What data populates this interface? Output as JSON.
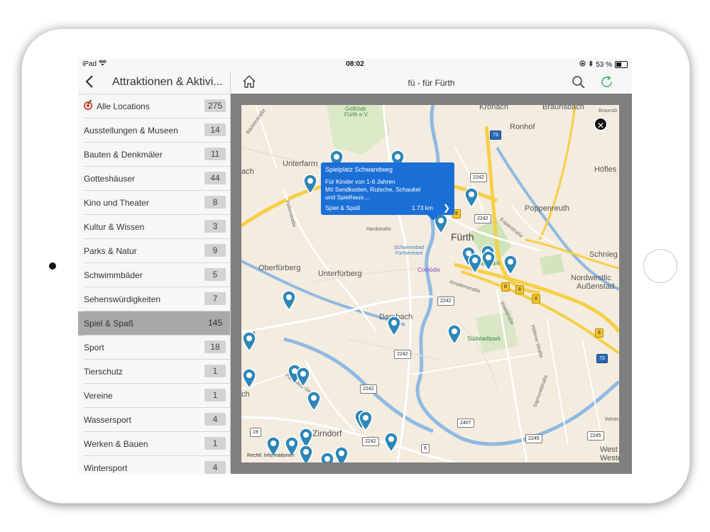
{
  "status_bar": {
    "device": "iPad",
    "time": "08:02",
    "battery": "53 %"
  },
  "sidebar": {
    "title": "Attraktionen & Aktivi...",
    "items": [
      {
        "label": "Alle Locations",
        "count": "275"
      },
      {
        "label": "Ausstellungen & Museen",
        "count": "14"
      },
      {
        "label": "Bauten & Denkmäler",
        "count": "11"
      },
      {
        "label": "Gotteshäuser",
        "count": "44"
      },
      {
        "label": "Kino und Theater",
        "count": "8"
      },
      {
        "label": "Kultur & Wissen",
        "count": "3"
      },
      {
        "label": "Parks & Natur",
        "count": "9"
      },
      {
        "label": "Schwimmbäder",
        "count": "5"
      },
      {
        "label": "Sehenswürdigkeiten",
        "count": "7"
      },
      {
        "label": "Spiel & Spaß",
        "count": "145"
      },
      {
        "label": "Sport",
        "count": "18"
      },
      {
        "label": "Tierschutz",
        "count": "1"
      },
      {
        "label": "Vereine",
        "count": "1"
      },
      {
        "label": "Wassersport",
        "count": "4"
      },
      {
        "label": "Werken & Bauen",
        "count": "1"
      },
      {
        "label": "Wintersport",
        "count": "4"
      }
    ],
    "selected_index": 9
  },
  "header": {
    "title": "fü - für Fürth"
  },
  "callout": {
    "title": "Spielplatz Schwandweg",
    "desc_line1": "Für Kinder von 1-6 Jahren",
    "desc_line2": "Mit Sandkasten, Rutsche, Schaukel",
    "desc_line3": "und Spielhaus....",
    "category": "Spiel & Spaß",
    "distance": "1.73 km"
  },
  "map": {
    "labels": {
      "kronach": "Kronach",
      "braunsbach": "Braunsbach",
      "braunsbach2": "Braunsb",
      "ronhof": "Ronhof",
      "hoefles": "Höfles",
      "unterfarrn": "Unterfarrn",
      "ach": "ach",
      "poppenreuth": "Poppenreuth",
      "fuerth": "Fürth",
      "schnieg": "Schnieg",
      "oberfuerberg": "Oberfürberg",
      "unterfuerberg": "Unterfürberg",
      "nordwestlic": "Nordwestlic",
      "aussenstad": "Außenstad",
      "dambach": "Dambach",
      "suedstadtpark": "Südstadtpark",
      "stadtpark": "Stadtpark",
      "zirndorf": "Zirndorf",
      "west": "West",
      "weste": "Weste",
      "wests": "Wests",
      "ch": "ch",
      "f": "f",
      "golfclub1": "Golfclub",
      "golfclub2": "Fürth e.V.",
      "schwimmbad1": "Schwimmbad",
      "schwimmbad2": "Fürthermare",
      "comodie": "Comödie",
      "hardstrasse": "Hardstraße",
      "amalienstrasse": "Amalienstraße",
      "esperstrasse": "Espanstraße",
      "waldstrasse": "Waldstraße",
      "hoefenerstrasse": "Höfener Straße",
      "sigmundstrasse": "Sigmundstraße",
      "hafenstrasse": "Hafenstraße",
      "baeckerstrasse": "Bäckerstraße",
      "paulmetzstrasse": "Paul-Metz-Str.",
      "legal": "Rechtl. Informationen"
    },
    "shields": {
      "s73a": "73",
      "s2242a": "2242",
      "s2242b": "2242",
      "s2242c": "2242",
      "s2242d": "2242",
      "s2242e": "2242",
      "s2242f": "2242",
      "s8a": "8",
      "s8b": "8",
      "s8c": "8",
      "s8d": "8",
      "s8e": "8",
      "s73b": "73",
      "s19": "19",
      "s2407": "2407",
      "s6": "6",
      "s2245a": "2245",
      "s2245b": "2245"
    }
  },
  "colors": {
    "accent": "#1c6fd6",
    "pin": "#2e86b8",
    "refresh": "#3ab56b",
    "selected_row": "#a9a9a9"
  }
}
